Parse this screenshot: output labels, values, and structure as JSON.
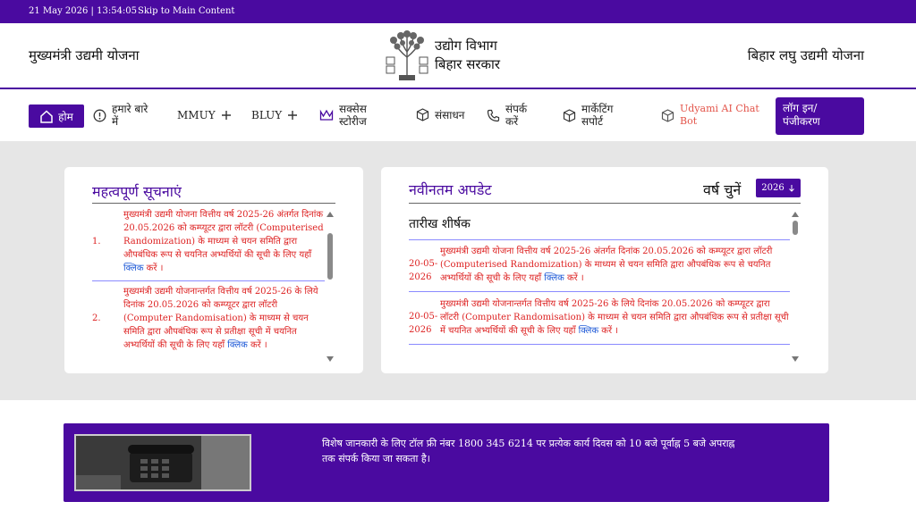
{
  "topbar": {
    "datetime": "21 May 2026 | 13:54:05",
    "skip": "Skip to Main Content"
  },
  "header": {
    "left_title": "मुख्यमंत्री उद्यमी योजना",
    "dept_line1": "उद्योग विभाग",
    "dept_line2": "बिहार सरकार",
    "right_title": "बिहार लघु उद्यमी योजना"
  },
  "nav": {
    "home": "होम",
    "about": "हमारे बारे में",
    "mmuy": "MMUY",
    "bluy": "BLUY",
    "success_stories": "सक्सेस स्टोरीज",
    "resources": "संसाधन",
    "contact": "संपर्क करें",
    "marketing": "मार्केटिंग सपोर्ट",
    "chatbot": "Udyami AI Chat Bot",
    "login": "लॉग इन/ पंजीकरण"
  },
  "notices": {
    "title": "महत्वपूर्ण सूचनाएं",
    "items": [
      {
        "num": "1.",
        "text": "मुख्यमंत्री उद्यमी योजना वित्तीय वर्ष 2025-26 अंतर्गत दिनांक 20.05.2026 को कम्प्यूटर द्वारा लॉटरी (Computerised Randomization) के माध्यम से चयन समिति द्वारा औपबंधिक रूप से चयनित अभ्यर्थियों की सूची के लिए यहाँ ",
        "link": "क्लिक",
        "tail": " करें ।"
      },
      {
        "num": "2.",
        "text": "मुख्यमंत्री उद्यमी योजनान्तर्गत वित्तीय वर्ष 2025-26 के लिये दिनांक 20.05.2026 को कम्प्यूटर द्वारा लॉटरी (Computer Randomisation) के माध्यम से चयन समिति द्वारा औपबंधिक रूप से प्रतीक्षा सूची में चयनित अभ्यर्थियों की सूची के लिए यहाँ ",
        "link": "क्लिक",
        "tail": " करें ।"
      }
    ]
  },
  "updates": {
    "title": "नवीनतम अपडेट",
    "year_label": "वर्ष चुनें",
    "year_value": "2026",
    "header": "तारीख शीर्षक",
    "items": [
      {
        "date": "20-05-2026",
        "text": "मुख्यमंत्री उद्यमी योजना वित्तीय वर्ष 2025-26 अंतर्गत दिनांक 20.05.2026 को कम्प्यूटर द्वारा लॉटरी (Computerised Randomization) के माध्यम से चयन समिति द्वारा औपबंधिक रूप से चयनित अभ्यर्थियों की सूची के लिए यहाँ ",
        "link": "क्लिक",
        "tail": " करें ।"
      },
      {
        "date": "20-05-2026",
        "text": "मुख्यमंत्री उद्यमी योजनान्तर्गत वित्तीय वर्ष 2025-26 के लिये दिनांक 20.05.2026 को कम्प्यूटर द्वारा लॉटरी (Computer Randomisation) के माध्यम से चयन समिति द्वारा औपबंधिक रूप से प्रतीक्षा सूची में चयनित अभ्यर्थियों की सूची के लिए यहाँ ",
        "link": "क्लिक",
        "tail": " करें ।"
      }
    ]
  },
  "banner": {
    "text": "विशेष जानकारी के लिए टॉल फ्री नंबर 1800 345 6214 पर प्रत्येक कार्य दिवस को 10 बजे पूर्वाह्न 5 बजे अपराह्न तक संपर्क किया जा सकता है।"
  },
  "colors": {
    "primary": "#4a0aa0",
    "notice_text": "#dd2222",
    "link": "#1a56d6",
    "chatbot": "#e3544a"
  }
}
